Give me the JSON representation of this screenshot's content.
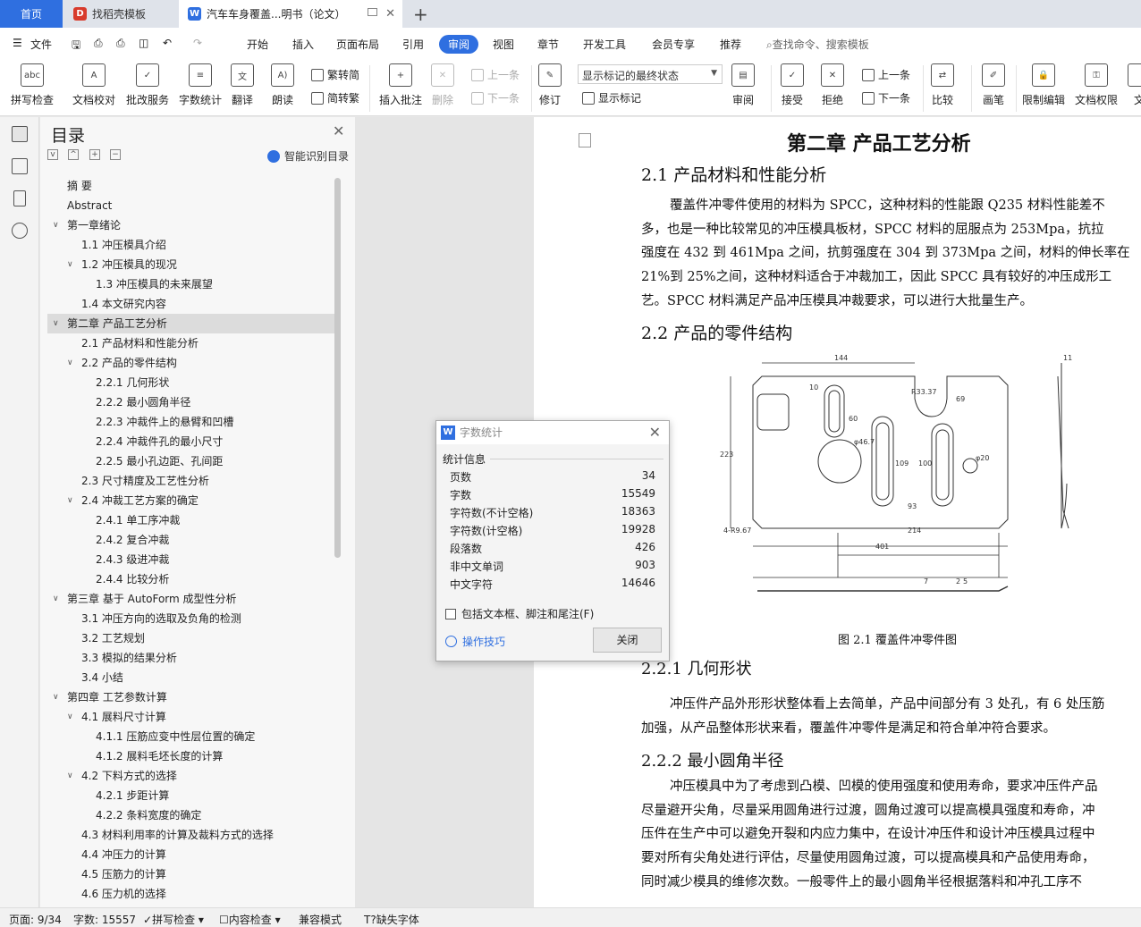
{
  "tabs": {
    "home": "首页",
    "template": "找稻壳模板",
    "document": "汽车车身覆盖...明书（论文）"
  },
  "menu": {
    "file": "文件",
    "items": [
      "开始",
      "插入",
      "页面布局",
      "引用",
      "审阅",
      "视图",
      "章节",
      "开发工具",
      "会员专享",
      "推荐"
    ],
    "search": "查找命令、搜索模板"
  },
  "ribbon": {
    "spellcheck": "拼写检查",
    "proofread": "文档校对",
    "batch_service": "批改服务",
    "word_count": "字数统计",
    "translate": "翻译",
    "read_aloud": "朗读",
    "trad_conv": "繁转简",
    "simp_conv": "简转繁",
    "insert_comment": "插入批注",
    "delete": "删除",
    "prev_comment": "上一条",
    "next_comment": "下一条",
    "revise": "修订",
    "display_mode": "显示标记的最终状态",
    "show_markup": "显示标记",
    "review": "审阅",
    "accept": "接受",
    "reject": "拒绝",
    "prev_change": "上一条",
    "next_change": "下一条",
    "compare": "比较",
    "pen": "画笔",
    "restrict_edit": "限制编辑",
    "doc_rights": "文档权限",
    "doc_cut": "文"
  },
  "nav": {
    "title": "目录",
    "smart_toc": "智能识别目录",
    "items": [
      {
        "label": "摘  要",
        "level": 0,
        "chev": ""
      },
      {
        "label": "Abstract",
        "level": 0,
        "chev": ""
      },
      {
        "label": "第一章绪论",
        "level": 0,
        "chev": "v"
      },
      {
        "label": "1.1 冲压模具介绍",
        "level": 1,
        "chev": ""
      },
      {
        "label": "1.2 冲压模具的现况",
        "level": 1,
        "chev": "v"
      },
      {
        "label": "1.3 冲压模具的未来展望",
        "level": 2,
        "chev": ""
      },
      {
        "label": "1.4 本文研究内容",
        "level": 1,
        "chev": ""
      },
      {
        "label": "第二章  产品工艺分析",
        "level": 0,
        "chev": "v",
        "selected": true
      },
      {
        "label": "2.1 产品材料和性能分析",
        "level": 1,
        "chev": ""
      },
      {
        "label": "2.2 产品的零件结构",
        "level": 1,
        "chev": "v"
      },
      {
        "label": "2.2.1  几何形状",
        "level": 2,
        "chev": ""
      },
      {
        "label": "2.2.2 最小圆角半径",
        "level": 2,
        "chev": ""
      },
      {
        "label": "2.2.3 冲裁件上的悬臂和凹槽",
        "level": 2,
        "chev": ""
      },
      {
        "label": "2.2.4 冲裁件孔的最小尺寸",
        "level": 2,
        "chev": ""
      },
      {
        "label": "2.2.5 最小孔边距、孔间距",
        "level": 2,
        "chev": ""
      },
      {
        "label": "2.3 尺寸精度及工艺性分析",
        "level": 1,
        "chev": ""
      },
      {
        "label": "2.4 冲裁工艺方案的确定",
        "level": 1,
        "chev": "v"
      },
      {
        "label": "2.4.1 单工序冲裁",
        "level": 2,
        "chev": ""
      },
      {
        "label": "2.4.2 复合冲裁",
        "level": 2,
        "chev": ""
      },
      {
        "label": "2.4.3 级进冲裁",
        "level": 2,
        "chev": ""
      },
      {
        "label": "2.4.4 比较分析",
        "level": 2,
        "chev": ""
      },
      {
        "label": "第三章  基于 AutoForm 成型性分析",
        "level": 0,
        "chev": "v"
      },
      {
        "label": "3.1  冲压方向的选取及负角的检测",
        "level": 1,
        "chev": ""
      },
      {
        "label": "3.2  工艺规划",
        "level": 1,
        "chev": ""
      },
      {
        "label": "3.3  模拟的结果分析",
        "level": 1,
        "chev": ""
      },
      {
        "label": "3.4  小结",
        "level": 1,
        "chev": ""
      },
      {
        "label": "第四章  工艺参数计算",
        "level": 0,
        "chev": "v"
      },
      {
        "label": "4.1 展料尺寸计算",
        "level": 1,
        "chev": "v"
      },
      {
        "label": "4.1.1 压筋应变中性层位置的确定",
        "level": 2,
        "chev": ""
      },
      {
        "label": "4.1.2 展料毛坯长度的计算",
        "level": 2,
        "chev": ""
      },
      {
        "label": "4.2 下料方式的选择",
        "level": 1,
        "chev": "v"
      },
      {
        "label": "4.2.1 步距计算",
        "level": 2,
        "chev": ""
      },
      {
        "label": "4.2.2 条料宽度的确定",
        "level": 2,
        "chev": ""
      },
      {
        "label": "4.3 材料利用率的计算及裁料方式的选择",
        "level": 1,
        "chev": ""
      },
      {
        "label": "4.4 冲压力的计算",
        "level": 1,
        "chev": ""
      },
      {
        "label": "4.5 压筋力的计算",
        "level": 1,
        "chev": ""
      },
      {
        "label": "4.6 压力机的选择",
        "level": 1,
        "chev": ""
      }
    ]
  },
  "document": {
    "chapter_title": "第二章  产品工艺分析",
    "sec21_title": "2.1 产品材料和性能分析",
    "sec21_lines": [
      "覆盖件冲零件使用的材料为 SPCC，这种材料的性能跟 Q235 材料性能差不",
      "多，也是一种比较常见的冲压模具板材，SPCC 材料的屈服点为 253Mpa，抗拉",
      "强度在 432 到 461Mpa 之间，抗剪强度在 304 到 373Mpa 之间，材料的伸长率在",
      "21%到 25%之间，这种材料适合于冲裁加工，因此 SPCC 具有较好的冲压成形工",
      "艺。SPCC 材料满足产品冲压模具冲裁要求，可以进行大批量生产。"
    ],
    "sec22_title": "2.2 产品的零件结构",
    "figure_caption": "图 2.1  覆盖件冲零件图",
    "dims": {
      "d144": "144",
      "d10": "10",
      "r33": "R33.37",
      "d69": "69",
      "d11": "11",
      "d60": "60",
      "d223": "223",
      "phi46": "φ46.7",
      "d109": "109",
      "d100": "100",
      "phi20": "φ20",
      "d93": "93",
      "d214": "214",
      "d401": "401",
      "r9967": "4-R9.67",
      "d7": "7",
      "d2": "2",
      "d5": "5"
    },
    "sec221_title": "2.2.1  几何形状",
    "sec221_lines": [
      "冲压件产品外形形状整体看上去简单，产品中间部分有 3 处孔，有 6 处压筋",
      "加强，从产品整体形状来看，覆盖件冲零件是满足和符合单冲符合要求。"
    ],
    "sec222_title": "2.2.2 最小圆角半径",
    "sec222_lines": [
      "冲压模具中为了考虑到凸模、凹模的使用强度和使用寿命，要求冲压件产品",
      "尽量避开尖角，尽量采用圆角进行过渡，圆角过渡可以提高模具强度和寿命，冲",
      "压件在生产中可以避免开裂和内应力集中，在设计冲压件和设计冲压模具过程中",
      "要对所有尖角处进行评估，尽量使用圆角过渡，可以提高模具和产品使用寿命，",
      "同时减少模具的维修次数。一般零件上的最小圆角半径根据落料和冲孔工序不"
    ]
  },
  "dialog": {
    "title": "字数统计",
    "section": "统计信息",
    "stats": [
      {
        "label": "页数",
        "value": "34"
      },
      {
        "label": "字数",
        "value": "15549"
      },
      {
        "label": "字符数(不计空格)",
        "value": "18363"
      },
      {
        "label": "字符数(计空格)",
        "value": "19928"
      },
      {
        "label": "段落数",
        "value": "426"
      },
      {
        "label": "非中文单词",
        "value": "903"
      },
      {
        "label": "中文字符",
        "value": "14646"
      }
    ],
    "checkbox": "包括文本框、脚注和尾注(F)",
    "tips": "操作技巧",
    "close": "关闭"
  },
  "status": {
    "page": "页面: 9/34",
    "words": "字数: 15557",
    "spell": "拼写检查",
    "content_check": "内容检查",
    "compat": "兼容模式",
    "missing_font": "缺失字体"
  }
}
